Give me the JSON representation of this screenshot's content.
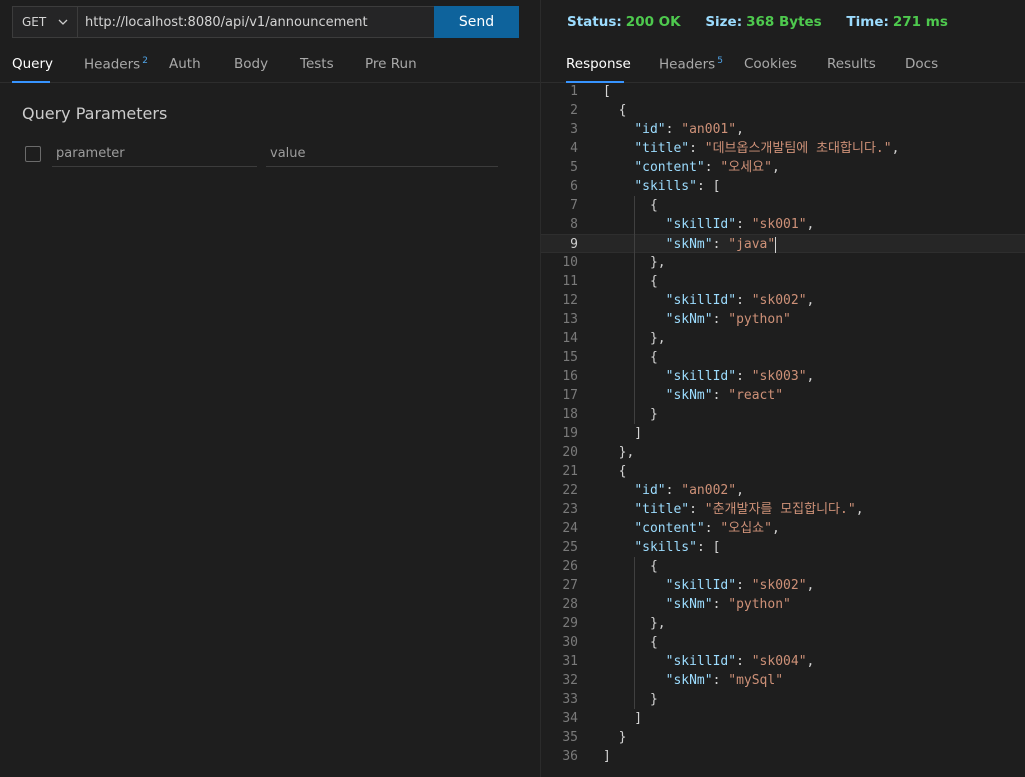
{
  "request": {
    "method": "GET",
    "url": "http://localhost:8080/api/v1/announcement",
    "send_label": "Send"
  },
  "request_tabs": [
    {
      "label": "Query",
      "active": true
    },
    {
      "label": "Headers",
      "badge": "2"
    },
    {
      "label": "Auth"
    },
    {
      "label": "Body"
    },
    {
      "label": "Tests"
    },
    {
      "label": "Pre Run"
    }
  ],
  "query": {
    "title": "Query Parameters",
    "param_placeholder": "parameter",
    "value_placeholder": "value"
  },
  "status": {
    "status_label": "Status:",
    "status_value": "200 OK",
    "size_label": "Size:",
    "size_value": "368 Bytes",
    "time_label": "Time:",
    "time_value": "271 ms",
    "value_color": "#4ec94e"
  },
  "response_tabs": [
    {
      "label": "Response",
      "active": true
    },
    {
      "label": "Headers",
      "badge": "5"
    },
    {
      "label": "Cookies"
    },
    {
      "label": "Results"
    },
    {
      "label": "Docs"
    }
  ],
  "icons": {
    "method_dropdown": "chevron-down-icon",
    "checkbox": "checkbox-icon"
  },
  "response_lines": [
    "[",
    "  {",
    "    \"id\": \"an001\",",
    "    \"title\": \"데브옵스개발팀에 초대합니다.\",",
    "    \"content\": \"오세요\",",
    "    \"skills\": [",
    "      {",
    "        \"skillId\": \"sk001\",",
    "        \"skNm\": \"java\"",
    "      },",
    "      {",
    "        \"skillId\": \"sk002\",",
    "        \"skNm\": \"python\"",
    "      },",
    "      {",
    "        \"skillId\": \"sk003\",",
    "        \"skNm\": \"react\"",
    "      }",
    "    ]",
    "  },",
    "  {",
    "    \"id\": \"an002\",",
    "    \"title\": \"춘개발자를 모집합니다.\",",
    "    \"content\": \"오십쇼\",",
    "    \"skills\": [",
    "      {",
    "        \"skillId\": \"sk002\",",
    "        \"skNm\": \"python\"",
    "      },",
    "      {",
    "        \"skillId\": \"sk004\",",
    "        \"skNm\": \"mySql\"",
    "      }",
    "    ]",
    "  }",
    "]"
  ],
  "editor": {
    "current_line": 9
  }
}
